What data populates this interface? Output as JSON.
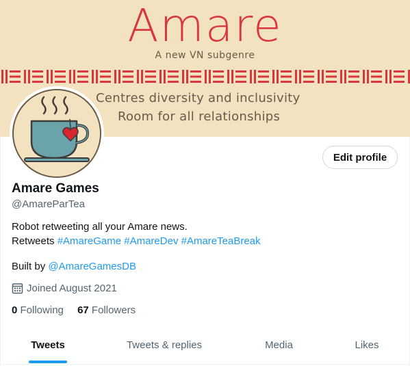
{
  "banner": {
    "title": "Amare",
    "subtitle": "A new VN subgenre",
    "line1": "Centres diversity and inclusivity",
    "line2": "Room for all relationships",
    "background": "#f2e2c0",
    "accent": "#d9363e"
  },
  "avatar": {
    "icon": "teacup-with-heart"
  },
  "actions": {
    "edit_profile": "Edit profile"
  },
  "profile": {
    "name": "Amare Games",
    "handle": "@AmareParTea",
    "bio_line1": "Robot retweeting all your Amare news.",
    "bio_prefix": "Retweets",
    "hashtags": [
      "#AmareGame",
      "#AmareDev",
      "#AmareTeaBreak"
    ],
    "built_prefix": "Built by",
    "built_by": "@AmareGamesDB",
    "joined": "Joined August 2021",
    "following_count": "0",
    "following_label": "Following",
    "followers_count": "67",
    "followers_label": "Followers"
  },
  "tabs": [
    {
      "label": "Tweets",
      "active": true
    },
    {
      "label": "Tweets & replies",
      "active": false
    },
    {
      "label": "Media",
      "active": false
    },
    {
      "label": "Likes",
      "active": false
    }
  ],
  "colors": {
    "link": "#1d9bf0",
    "text": "#0f1419",
    "muted": "#536471"
  }
}
